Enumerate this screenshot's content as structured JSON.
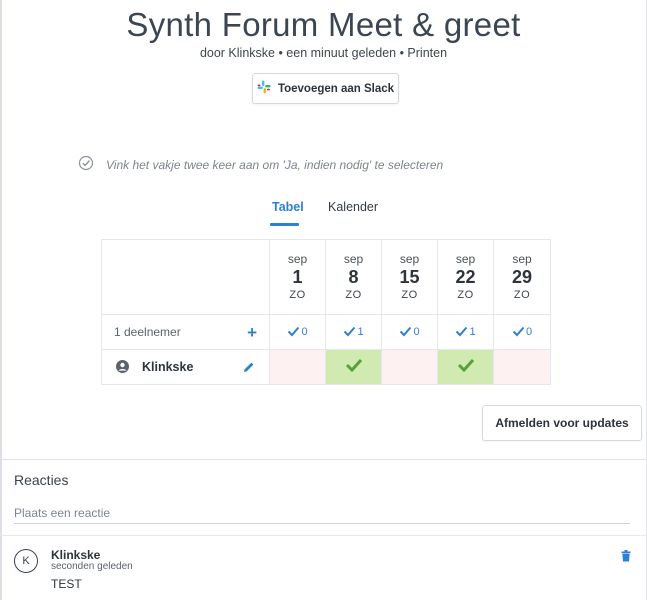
{
  "poll": {
    "title": "Synth Forum Meet & greet",
    "meta": "door Klinkske • een minuut geleden • Printen",
    "slack_button": "Toevoegen aan Slack",
    "hint": "Vink het vakje twee keer aan om 'Ja, indien nodig' te selecteren"
  },
  "tabs": [
    {
      "label": "Tabel",
      "active": true
    },
    {
      "label": "Kalender",
      "active": false
    }
  ],
  "table": {
    "participants_label": "1 deelnemer",
    "dates": [
      {
        "month": "sep",
        "day": "1",
        "weekday": "ZO",
        "count": "0"
      },
      {
        "month": "sep",
        "day": "8",
        "weekday": "ZO",
        "count": "1"
      },
      {
        "month": "sep",
        "day": "15",
        "weekday": "ZO",
        "count": "0"
      },
      {
        "month": "sep",
        "day": "22",
        "weekday": "ZO",
        "count": "1"
      },
      {
        "month": "sep",
        "day": "29",
        "weekday": "ZO",
        "count": "0"
      }
    ],
    "participant": {
      "name": "Klinkske",
      "votes": [
        "no",
        "yes",
        "no",
        "yes",
        "no"
      ]
    }
  },
  "unsubscribe_button": "Afmelden voor updates",
  "comments": {
    "title": "Reacties",
    "placeholder": "Plaats een reactie",
    "items": [
      {
        "initial": "K",
        "author": "Klinkske",
        "time": "seconden geleden",
        "text": "TEST"
      }
    ]
  },
  "colors": {
    "accent": "#2f7fd6",
    "yes_bg": "#d0eab2",
    "yes_check": "#5aa03a",
    "no_bg": "#fdf1f1"
  }
}
